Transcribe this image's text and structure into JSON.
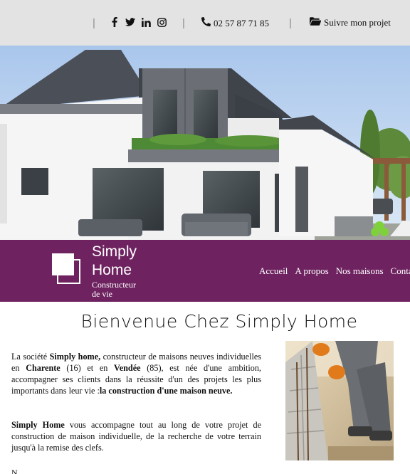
{
  "topbar": {
    "social_icons": [
      "facebook-icon",
      "twitter-icon",
      "linkedin-icon",
      "instagram-icon"
    ],
    "phone": "02 57 87 71 85",
    "project_link": "Suivre mon projet"
  },
  "brand": {
    "name_line1": "Simply",
    "name_line2": "Home",
    "tagline_line1": "Constructeur",
    "tagline_line2": "de vie",
    "accent_color": "#6e2360"
  },
  "nav": [
    "Accueil",
    "A propos",
    "Nos maisons",
    "Conta"
  ],
  "main": {
    "title": "Bienvenue Chez Simply Home",
    "p1": {
      "t1": "La société ",
      "b1": "Simply home,",
      "t2": " constructeur de maisons neuves individuelles en ",
      "b2": "Charente",
      "t3": " (16) et en ",
      "b3": "Vendée",
      "t4": " (85), est née d'une ambition, accompagner ses clients dans la réussite d'un des projets les plus importants dans leur vie :",
      "b4": "la construction d'une maison neuve."
    },
    "p2": {
      "b1": "Simply Home",
      "t1": " vous accompagne tout au long de votre projet de construction de maison individuelle, de la recherche de votre terrain jusqu'à la remise des clefs."
    },
    "trail": "N"
  }
}
